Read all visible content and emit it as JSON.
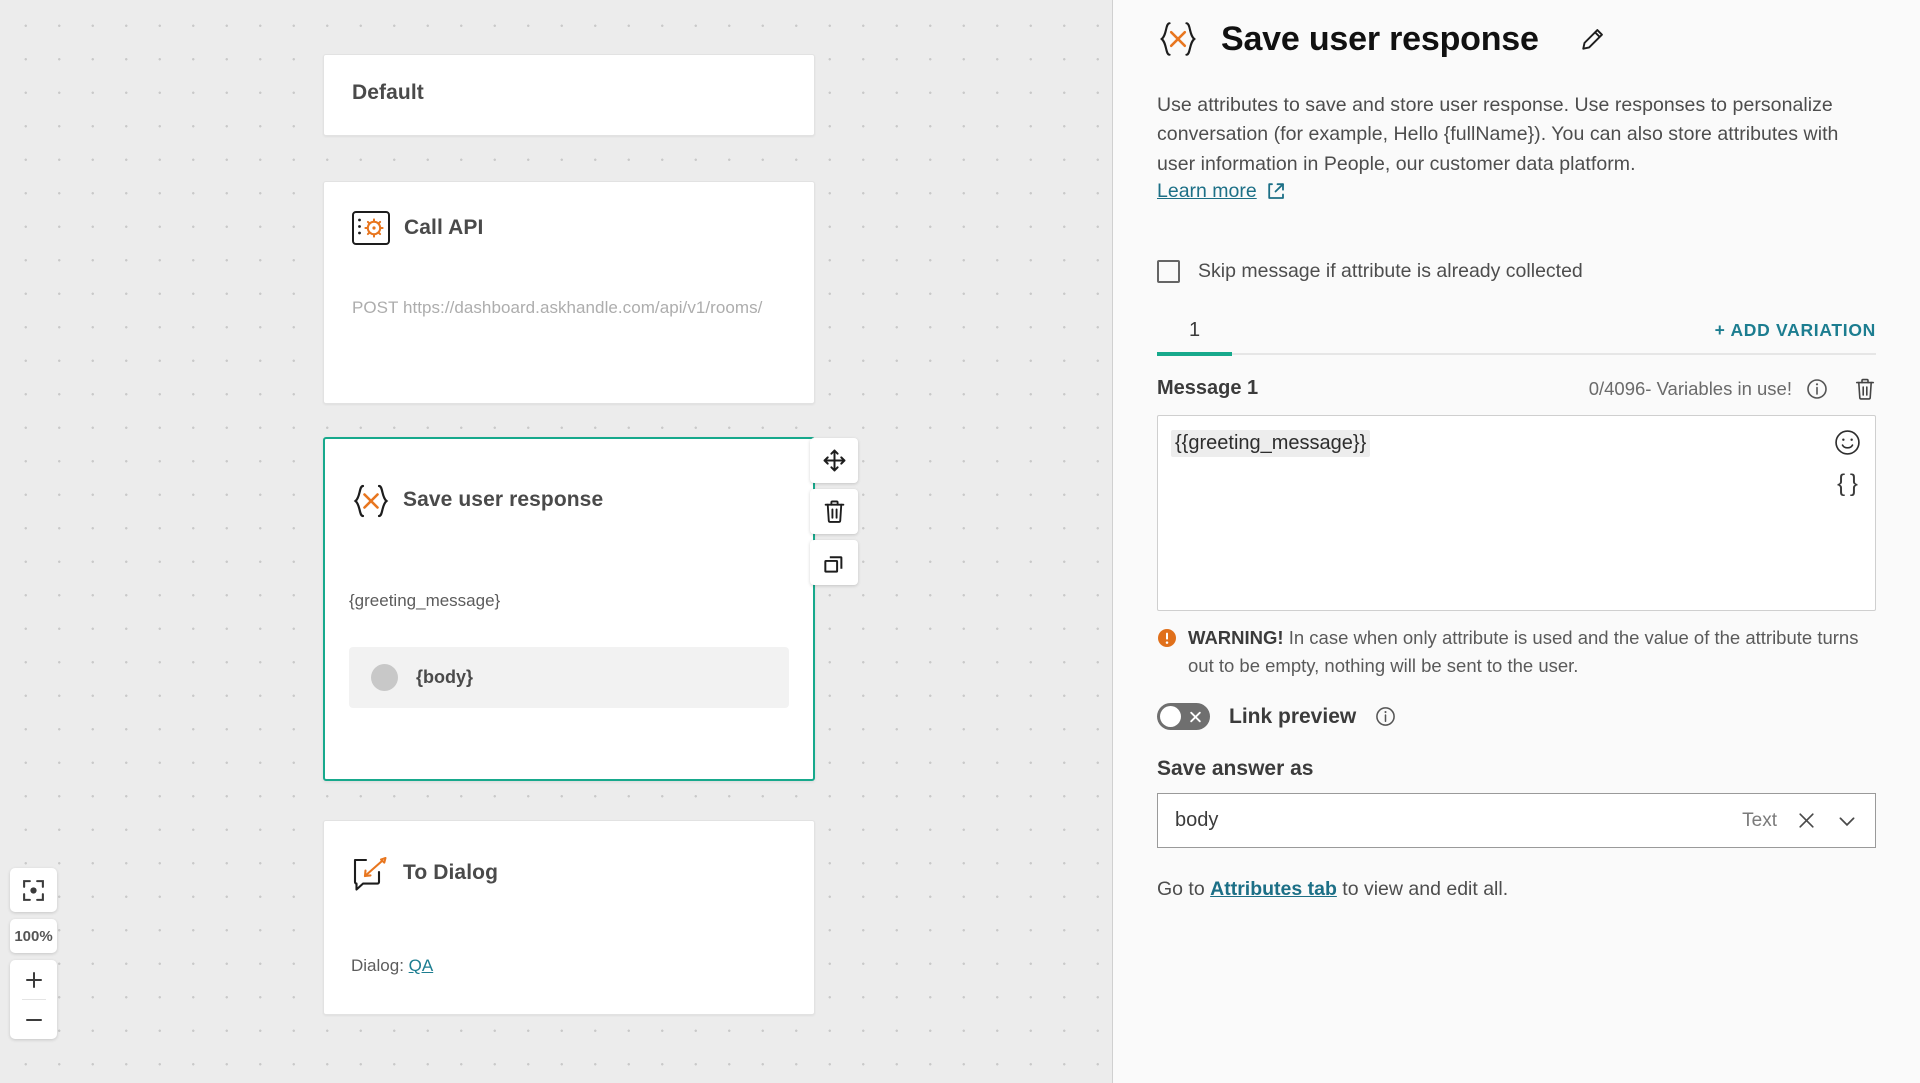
{
  "canvas": {
    "zoom_controls": {
      "fit_icon": "fit-to-screen-icon",
      "zoom_level": "100%",
      "zoom_in_icon": "plus-icon",
      "zoom_out_icon": "minus-icon"
    },
    "node_actions": [
      {
        "name": "move",
        "icon": "move-arrows-icon"
      },
      {
        "name": "delete",
        "icon": "trash-icon"
      },
      {
        "name": "duplicate",
        "icon": "copy-icon"
      }
    ],
    "cards": [
      {
        "id": "default",
        "title": "Default",
        "icon": null,
        "selected": false
      },
      {
        "id": "call-api",
        "title": "Call API",
        "icon": "api-gear-icon",
        "subtitle": "POST https://dashboard.askhandle.com/api/v1/rooms/",
        "selected": false
      },
      {
        "id": "save-user-response",
        "title": "Save user response",
        "icon": "curly-braces-x-icon",
        "subtitle": "{greeting_message}",
        "pill_label": "{body}",
        "selected": true
      },
      {
        "id": "to-dialog",
        "title": "To Dialog",
        "icon": "dialog-arrow-icon",
        "subtitle_prefix": "Dialog: ",
        "subtitle_link": "QA",
        "selected": false
      }
    ]
  },
  "panel": {
    "icon": "curly-braces-x-icon",
    "title": "Save user response",
    "edit_icon": "pencil-icon",
    "description": "Use attributes to save and store user response. Use responses to personalize conversation (for example, Hello {fullName}). You can also store attributes with user information in People, our customer data platform.",
    "learn_more": "Learn more",
    "learn_more_icon": "external-link-icon",
    "skip_checkbox": {
      "label": "Skip message if attribute is already collected",
      "checked": false
    },
    "tabs": {
      "active": "1",
      "add_variation": "+ ADD VARIATION"
    },
    "message": {
      "label": "Message 1",
      "counter": "0/4096- Variables in use!",
      "info_icon": "info-icon",
      "delete_icon": "trash-icon",
      "value": "{{greeting_message}}",
      "emoji_icon": "emoji-smile-icon",
      "variables_icon": "curly-braces-icon"
    },
    "warning": {
      "icon": "warning-icon",
      "bold": "WARNING!",
      "text": " In case when only attribute is used and the value of the attribute turns out to be empty, nothing will be sent to the user."
    },
    "link_preview": {
      "label": "Link preview",
      "enabled": false,
      "info_icon": "info-icon"
    },
    "save_answer": {
      "label": "Save answer as",
      "value": "body",
      "type": "Text",
      "clear_icon": "close-x-icon",
      "chevron_icon": "chevron-down-icon"
    },
    "footnote": {
      "prefix": "Go to ",
      "link": "Attributes tab",
      "suffix": " to view and edit all."
    },
    "colors": {
      "accent_teal": "#17a98c",
      "link_blue": "#1c7d90",
      "warning_orange": "#e0701b",
      "icon_orange": "#e8761f"
    }
  }
}
